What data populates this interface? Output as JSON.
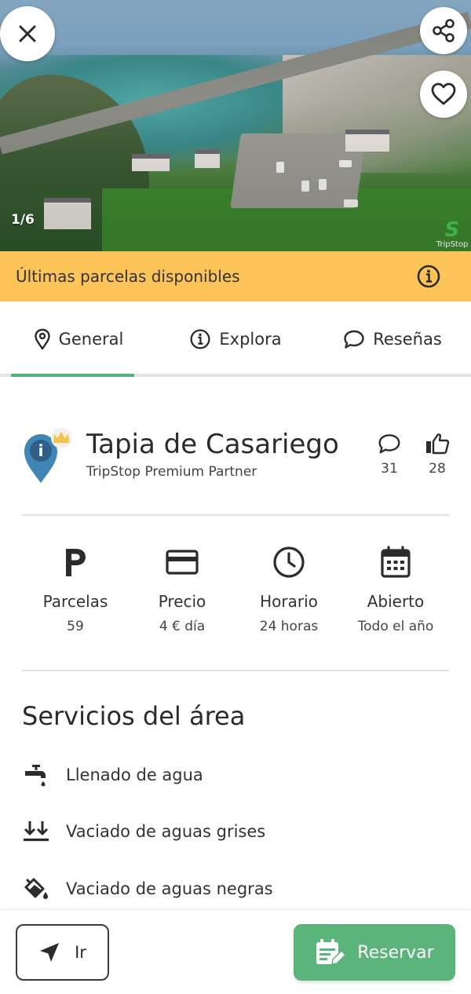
{
  "hero": {
    "counter": "1/6",
    "watermark": "TripStop"
  },
  "banner": {
    "text": "Últimas parcelas disponibles"
  },
  "tabs": [
    {
      "label": "General",
      "icon": "location-pin-icon",
      "active": true
    },
    {
      "label": "Explora",
      "icon": "info-icon",
      "active": false
    },
    {
      "label": "Reseñas",
      "icon": "comment-icon",
      "active": false
    }
  ],
  "place": {
    "title": "Tapia de Casariego",
    "subtitle": "TripStop Premium Partner",
    "comments_count": "31",
    "likes_count": "28"
  },
  "info": [
    {
      "label": "Parcelas",
      "value": "59",
      "icon": "parking-icon"
    },
    {
      "label": "Precio",
      "value": "4 € día",
      "icon": "credit-card-icon"
    },
    {
      "label": "Horario",
      "value": "24 horas",
      "icon": "clock-icon"
    },
    {
      "label": "Abierto",
      "value": "Todo el año",
      "icon": "calendar-icon"
    }
  ],
  "services": {
    "title": "Servicios del área",
    "items": [
      {
        "label": "Llenado de agua",
        "icon": "water-tap-icon"
      },
      {
        "label": "Vaciado de aguas grises",
        "icon": "grey-water-drain-icon"
      },
      {
        "label": "Vaciado de aguas negras",
        "icon": "black-water-drain-icon"
      }
    ]
  },
  "actions": {
    "go_label": "Ir",
    "book_label": "Reservar"
  },
  "colors": {
    "accent_green": "#5bb57a",
    "banner_yellow": "#fcc458",
    "pin_blue": "#3d86b5",
    "crown_gold": "#f5c24c"
  }
}
